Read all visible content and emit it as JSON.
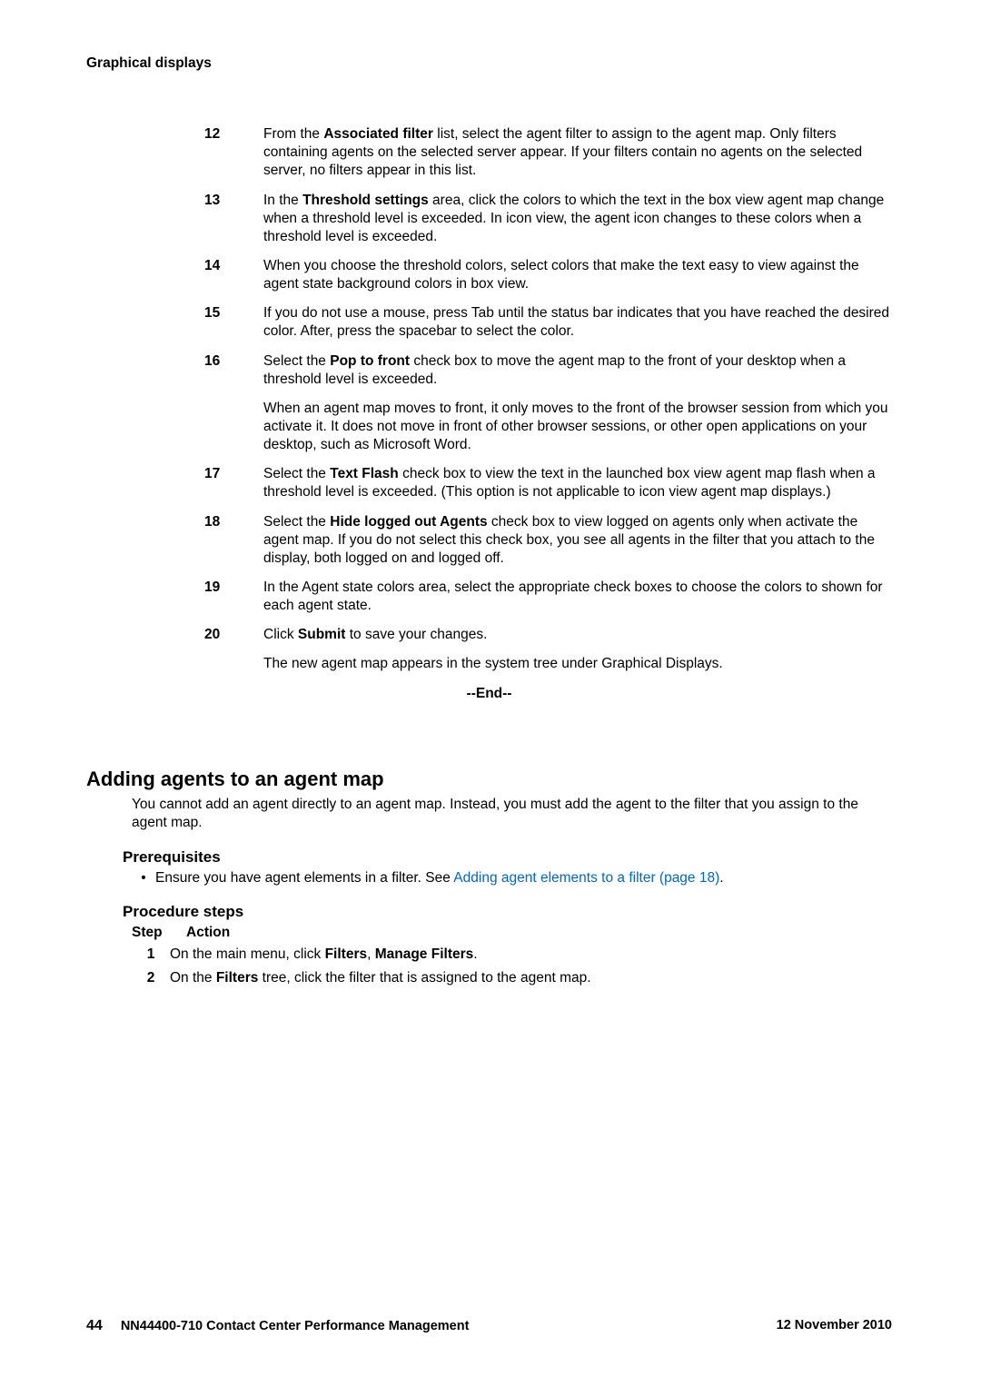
{
  "header": {
    "section": "Graphical displays"
  },
  "steps": [
    {
      "n": "12",
      "paras": [
        "From the <b>Associated filter</b> list, select the agent filter to assign to the agent map. Only filters containing agents on the selected server appear. If your filters contain no agents on the selected server, no filters appear in this list."
      ]
    },
    {
      "n": "13",
      "paras": [
        "In the <b>Threshold settings</b> area, click the colors to which the text in the box view agent map change when a threshold level is exceeded. In icon view, the agent icon changes to these colors when a threshold level is exceeded."
      ]
    },
    {
      "n": "14",
      "paras": [
        "When you choose the threshold colors, select colors that make the text easy to view against the agent state background colors in box view."
      ]
    },
    {
      "n": "15",
      "paras": [
        "If you do not use a mouse, press Tab until the status bar indicates that you have reached the desired color. After, press the spacebar to select the color."
      ]
    },
    {
      "n": "16",
      "paras": [
        "Select the <b>Pop to front</b> check box to move the agent map to the front of your desktop when a threshold level is exceeded.",
        "When an agent map moves to front, it only moves to the front of the browser session from which you activate it. It does not move in front of other browser sessions, or other open applications on your desktop, such as Microsoft Word."
      ]
    },
    {
      "n": "17",
      "paras": [
        "Select the <b>Text Flash</b> check box to view the text in the launched box view agent map flash when a threshold level is exceeded. (This option is not applicable to icon view agent map displays.)"
      ]
    },
    {
      "n": "18",
      "paras": [
        "Select the <b>Hide logged out Agents</b> check box to view logged on agents only when activate the agent map. If you do not select this check box, you see all agents in the filter that you attach to the display, both logged on and logged off."
      ]
    },
    {
      "n": "19",
      "paras": [
        "In the Agent state colors area, select the appropriate check boxes to choose the colors to shown for each agent state."
      ]
    },
    {
      "n": "20",
      "paras": [
        "Click <b>Submit</b> to save your changes.",
        "The new agent map appears in the system tree under Graphical Displays."
      ]
    }
  ],
  "end_marker": "--End--",
  "section2": {
    "title": "Adding agents to an agent map",
    "intro": "You cannot add an agent directly to an agent map. Instead, you must add the agent to the filter that you assign to the agent map.",
    "prereq_title": "Prerequisites",
    "bullet_plain": "Ensure you have agent elements in a filter. See ",
    "bullet_link": "Adding agent elements to a filter (page 18)",
    "bullet_tail": ".",
    "proc_title": "Procedure steps",
    "proc_h_step": "Step",
    "proc_h_action": "Action",
    "proc_steps": [
      {
        "n": "1",
        "body": "On the main menu, click <b>Filters</b>, <b>Manage Filters</b>."
      },
      {
        "n": "2",
        "body": "On the <b>Filters</b> tree, click the filter that is assigned to the agent map."
      }
    ]
  },
  "footer": {
    "page": "44",
    "title": "NN44400-710 Contact Center Performance Management",
    "date": "12 November 2010"
  }
}
